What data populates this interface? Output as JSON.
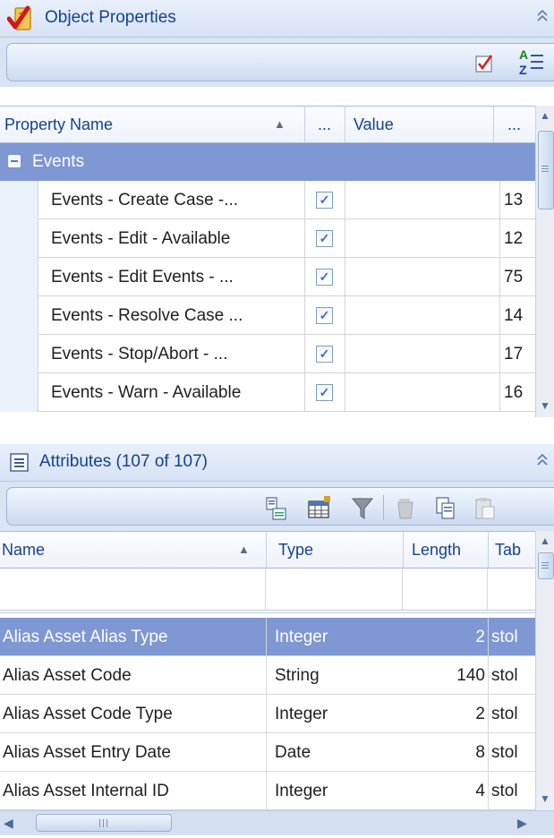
{
  "object_properties": {
    "title": "Object Properties",
    "columns": {
      "name": "Property Name",
      "check": "...",
      "value": "Value",
      "extra": "..."
    },
    "group": {
      "label": "Events",
      "toggle_glyph": "⊟"
    },
    "rows": [
      {
        "name": "Events - Create Case -...",
        "checked": true,
        "value": "",
        "extra": "13"
      },
      {
        "name": "Events - Edit - Available",
        "checked": true,
        "value": "",
        "extra": "12"
      },
      {
        "name": "Events - Edit Events - ...",
        "checked": true,
        "value": "",
        "extra": "75"
      },
      {
        "name": "Events - Resolve Case ...",
        "checked": true,
        "value": "",
        "extra": "14"
      },
      {
        "name": "Events - Stop/Abort - ...",
        "checked": true,
        "value": "",
        "extra": "17"
      },
      {
        "name": "Events - Warn - Available",
        "checked": true,
        "value": "",
        "extra": "16"
      }
    ],
    "toolbar": {
      "az_top": "A",
      "az_bottom": "Z"
    }
  },
  "attributes": {
    "title": "Attributes (107 of 107)",
    "columns": {
      "name": "Name",
      "type": "Type",
      "length": "Length",
      "table": "Tab"
    },
    "rows": [
      {
        "name": "Alias Asset Alias Type",
        "type": "Integer",
        "length": "2",
        "table": "stol",
        "selected": true
      },
      {
        "name": "Alias Asset Code",
        "type": "String",
        "length": "140",
        "table": "stol",
        "selected": false
      },
      {
        "name": "Alias Asset Code Type",
        "type": "Integer",
        "length": "2",
        "table": "stol",
        "selected": false
      },
      {
        "name": "Alias Asset Entry Date",
        "type": "Date",
        "length": "8",
        "table": "stol",
        "selected": false
      },
      {
        "name": "Alias Asset Internal ID",
        "type": "Integer",
        "length": "4",
        "table": "stol",
        "selected": false
      }
    ]
  },
  "colors": {
    "header_text": "#15428b",
    "group_band": "#7f97d3",
    "selected_row": "#7f97d3",
    "check_mark": "#3a6fcb"
  }
}
